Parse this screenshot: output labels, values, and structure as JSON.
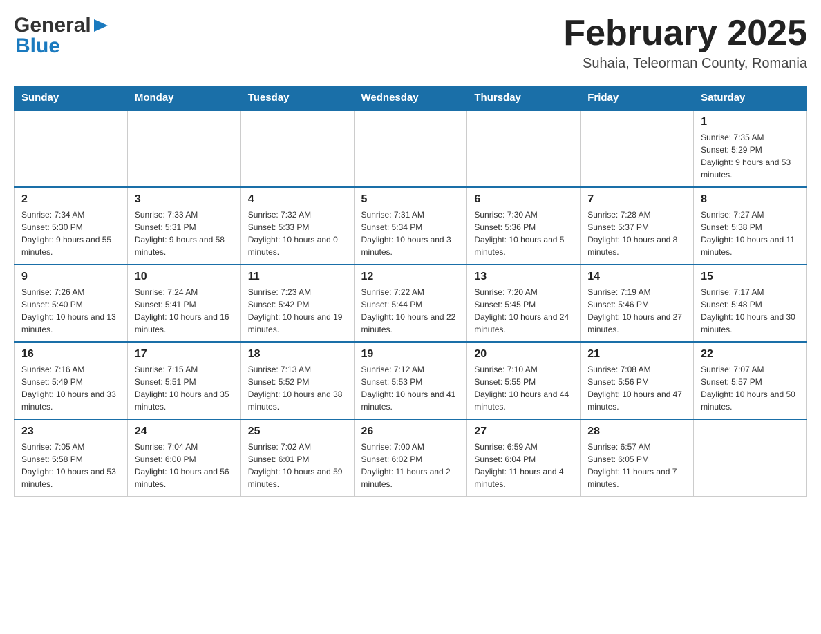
{
  "header": {
    "logo_general": "General",
    "logo_blue": "Blue",
    "month_title": "February 2025",
    "subtitle": "Suhaia, Teleorman County, Romania"
  },
  "days_of_week": [
    "Sunday",
    "Monday",
    "Tuesday",
    "Wednesday",
    "Thursday",
    "Friday",
    "Saturday"
  ],
  "weeks": [
    [
      {
        "day": "",
        "info": ""
      },
      {
        "day": "",
        "info": ""
      },
      {
        "day": "",
        "info": ""
      },
      {
        "day": "",
        "info": ""
      },
      {
        "day": "",
        "info": ""
      },
      {
        "day": "",
        "info": ""
      },
      {
        "day": "1",
        "info": "Sunrise: 7:35 AM\nSunset: 5:29 PM\nDaylight: 9 hours and 53 minutes."
      }
    ],
    [
      {
        "day": "2",
        "info": "Sunrise: 7:34 AM\nSunset: 5:30 PM\nDaylight: 9 hours and 55 minutes."
      },
      {
        "day": "3",
        "info": "Sunrise: 7:33 AM\nSunset: 5:31 PM\nDaylight: 9 hours and 58 minutes."
      },
      {
        "day": "4",
        "info": "Sunrise: 7:32 AM\nSunset: 5:33 PM\nDaylight: 10 hours and 0 minutes."
      },
      {
        "day": "5",
        "info": "Sunrise: 7:31 AM\nSunset: 5:34 PM\nDaylight: 10 hours and 3 minutes."
      },
      {
        "day": "6",
        "info": "Sunrise: 7:30 AM\nSunset: 5:36 PM\nDaylight: 10 hours and 5 minutes."
      },
      {
        "day": "7",
        "info": "Sunrise: 7:28 AM\nSunset: 5:37 PM\nDaylight: 10 hours and 8 minutes."
      },
      {
        "day": "8",
        "info": "Sunrise: 7:27 AM\nSunset: 5:38 PM\nDaylight: 10 hours and 11 minutes."
      }
    ],
    [
      {
        "day": "9",
        "info": "Sunrise: 7:26 AM\nSunset: 5:40 PM\nDaylight: 10 hours and 13 minutes."
      },
      {
        "day": "10",
        "info": "Sunrise: 7:24 AM\nSunset: 5:41 PM\nDaylight: 10 hours and 16 minutes."
      },
      {
        "day": "11",
        "info": "Sunrise: 7:23 AM\nSunset: 5:42 PM\nDaylight: 10 hours and 19 minutes."
      },
      {
        "day": "12",
        "info": "Sunrise: 7:22 AM\nSunset: 5:44 PM\nDaylight: 10 hours and 22 minutes."
      },
      {
        "day": "13",
        "info": "Sunrise: 7:20 AM\nSunset: 5:45 PM\nDaylight: 10 hours and 24 minutes."
      },
      {
        "day": "14",
        "info": "Sunrise: 7:19 AM\nSunset: 5:46 PM\nDaylight: 10 hours and 27 minutes."
      },
      {
        "day": "15",
        "info": "Sunrise: 7:17 AM\nSunset: 5:48 PM\nDaylight: 10 hours and 30 minutes."
      }
    ],
    [
      {
        "day": "16",
        "info": "Sunrise: 7:16 AM\nSunset: 5:49 PM\nDaylight: 10 hours and 33 minutes."
      },
      {
        "day": "17",
        "info": "Sunrise: 7:15 AM\nSunset: 5:51 PM\nDaylight: 10 hours and 35 minutes."
      },
      {
        "day": "18",
        "info": "Sunrise: 7:13 AM\nSunset: 5:52 PM\nDaylight: 10 hours and 38 minutes."
      },
      {
        "day": "19",
        "info": "Sunrise: 7:12 AM\nSunset: 5:53 PM\nDaylight: 10 hours and 41 minutes."
      },
      {
        "day": "20",
        "info": "Sunrise: 7:10 AM\nSunset: 5:55 PM\nDaylight: 10 hours and 44 minutes."
      },
      {
        "day": "21",
        "info": "Sunrise: 7:08 AM\nSunset: 5:56 PM\nDaylight: 10 hours and 47 minutes."
      },
      {
        "day": "22",
        "info": "Sunrise: 7:07 AM\nSunset: 5:57 PM\nDaylight: 10 hours and 50 minutes."
      }
    ],
    [
      {
        "day": "23",
        "info": "Sunrise: 7:05 AM\nSunset: 5:58 PM\nDaylight: 10 hours and 53 minutes."
      },
      {
        "day": "24",
        "info": "Sunrise: 7:04 AM\nSunset: 6:00 PM\nDaylight: 10 hours and 56 minutes."
      },
      {
        "day": "25",
        "info": "Sunrise: 7:02 AM\nSunset: 6:01 PM\nDaylight: 10 hours and 59 minutes."
      },
      {
        "day": "26",
        "info": "Sunrise: 7:00 AM\nSunset: 6:02 PM\nDaylight: 11 hours and 2 minutes."
      },
      {
        "day": "27",
        "info": "Sunrise: 6:59 AM\nSunset: 6:04 PM\nDaylight: 11 hours and 4 minutes."
      },
      {
        "day": "28",
        "info": "Sunrise: 6:57 AM\nSunset: 6:05 PM\nDaylight: 11 hours and 7 minutes."
      },
      {
        "day": "",
        "info": ""
      }
    ]
  ]
}
